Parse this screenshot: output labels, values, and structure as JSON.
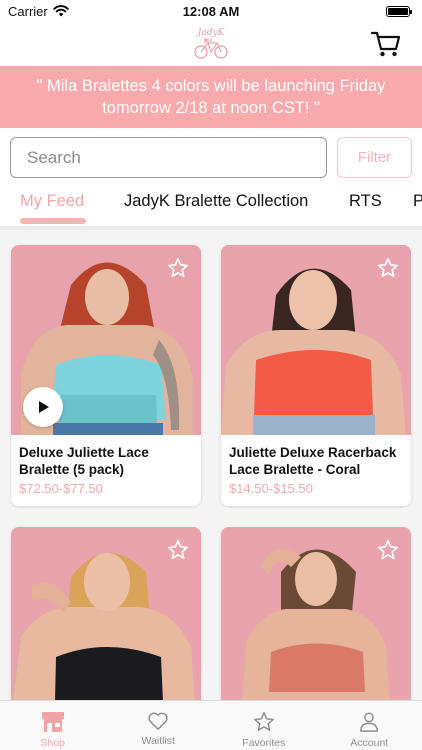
{
  "status_bar": {
    "carrier": "Carrier",
    "time": "12:08 AM"
  },
  "header": {
    "logo_text": "JadyK",
    "logo_icon": "bicycle-logo-icon",
    "cart_icon": "cart-icon"
  },
  "banner": {
    "text": "\" Mila Bralettes 4 colors will be launching Friday tomorrow 2/18 at noon CST! \""
  },
  "search": {
    "placeholder": "Search",
    "filter_label": "Filter"
  },
  "tabs": [
    {
      "label": "My Feed",
      "active": true
    },
    {
      "label": "JadyK Bralette Collection",
      "active": false
    },
    {
      "label": "RTS",
      "active": false
    },
    {
      "label": "P",
      "active": false
    }
  ],
  "products": [
    {
      "title": "Deluxe Juliette Lace Bralette  (5 pack)",
      "price": "$72.50-$77.50",
      "color": "#7fd3dc",
      "has_video": true
    },
    {
      "title": "Juliette Deluxe Racerback Lace Bralette - Coral",
      "price": "$14.50-$15.50",
      "color": "#f25c46",
      "has_video": false
    },
    {
      "title": "",
      "price": "",
      "color": "#1b1b1d",
      "has_video": false
    },
    {
      "title": "",
      "price": "",
      "color": "#d97968",
      "has_video": false
    }
  ],
  "tab_bar": [
    {
      "label": "Shop",
      "icon": "storefront-icon",
      "active": true
    },
    {
      "label": "Waitlist",
      "icon": "heart-icon",
      "active": false
    },
    {
      "label": "Favorites",
      "icon": "star-icon",
      "active": false
    },
    {
      "label": "Account",
      "icon": "person-icon",
      "active": false
    }
  ],
  "colors": {
    "accent": "#f1a4a8",
    "banner": "#f7a9ac",
    "photo_background": "#e8a3ad"
  }
}
